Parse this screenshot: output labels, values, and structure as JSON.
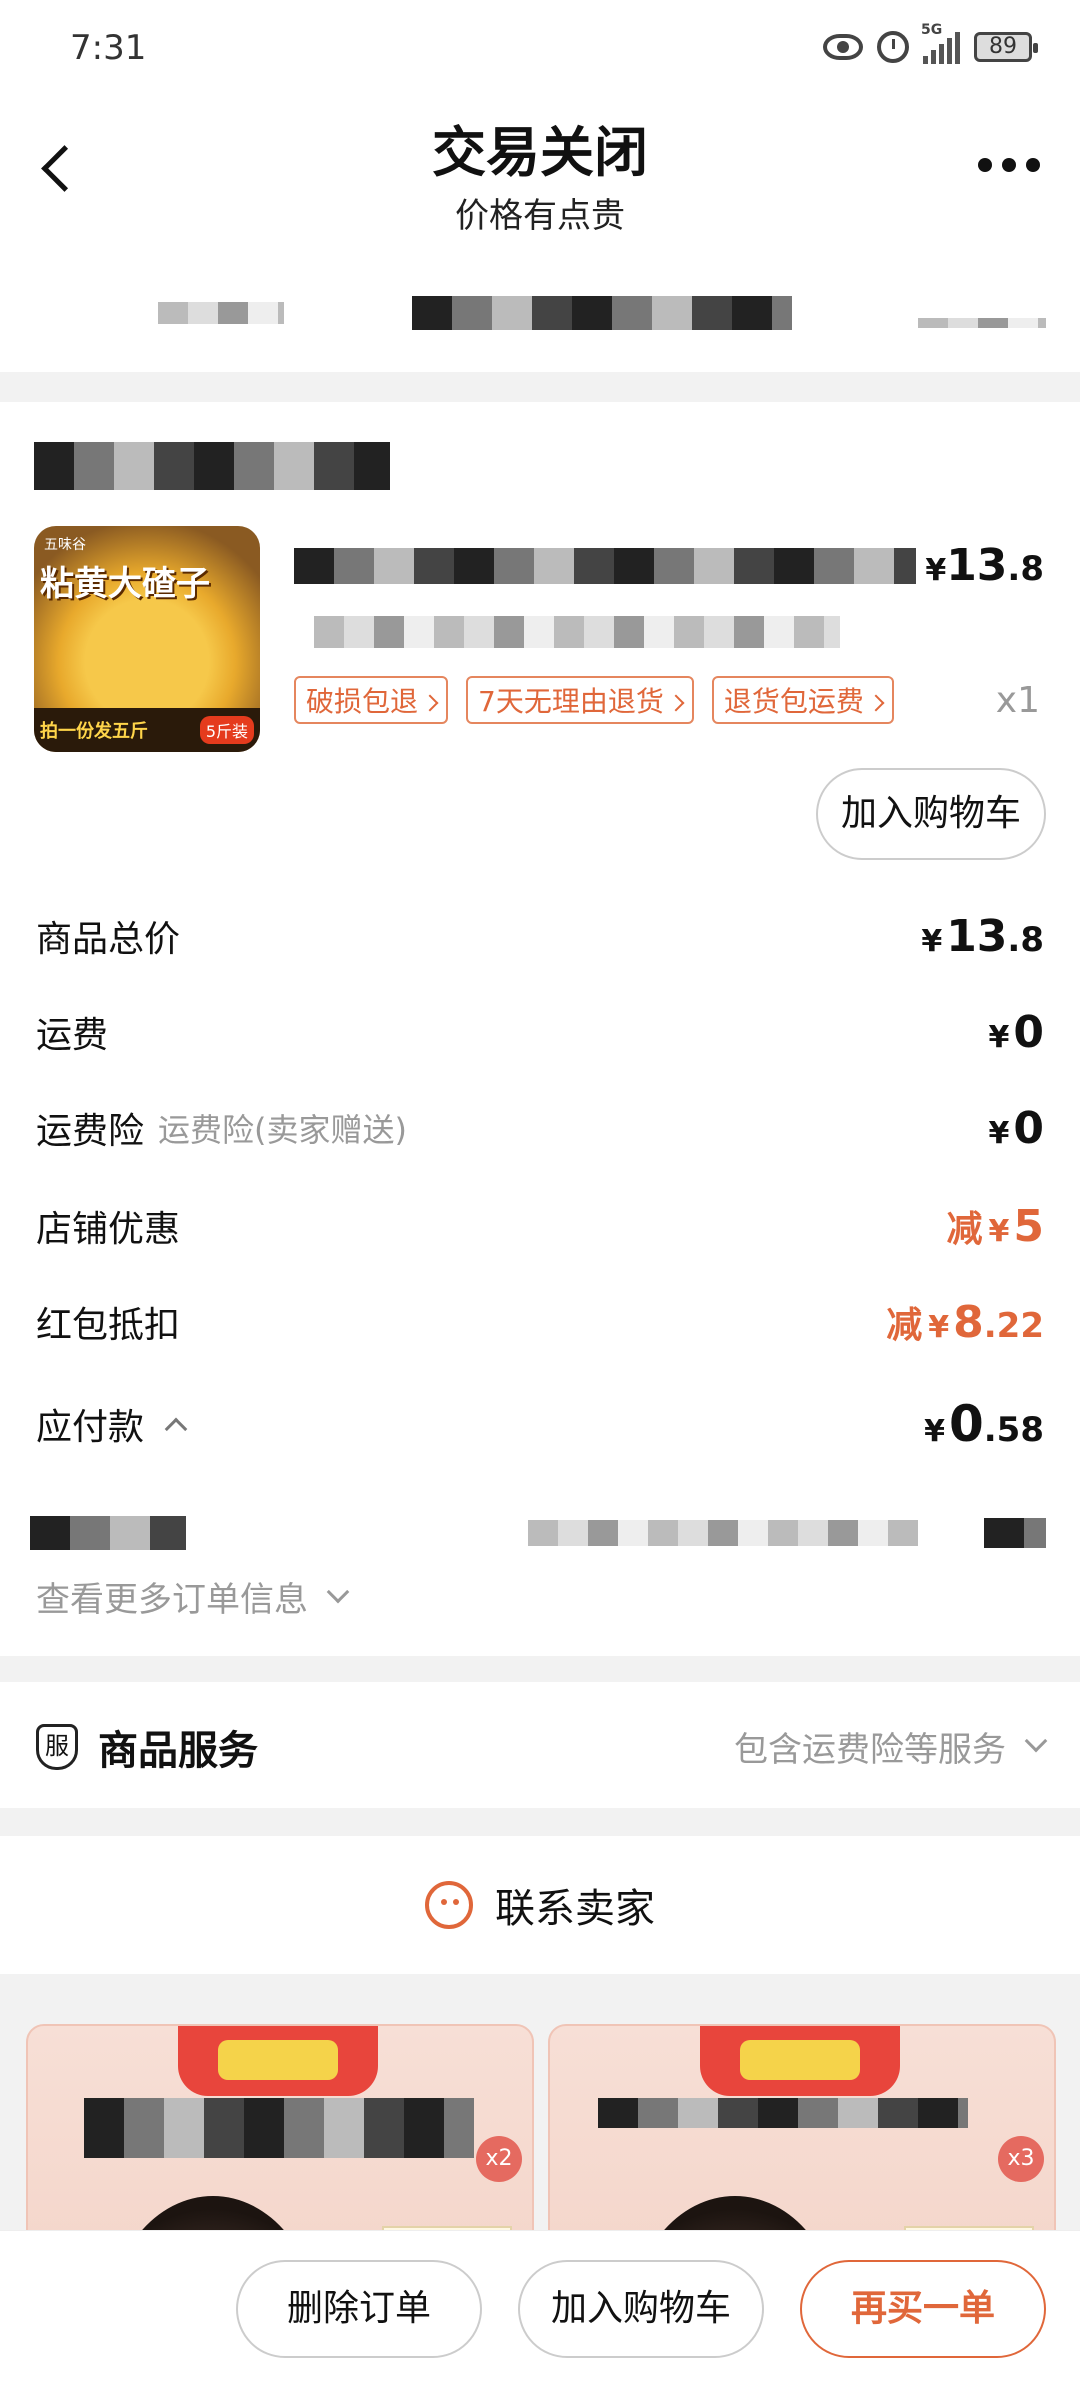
{
  "status_bar": {
    "time": "7:31",
    "network": "5G",
    "battery": "89"
  },
  "header": {
    "title": "交易关闭",
    "subtitle": "价格有点贵"
  },
  "product": {
    "image_text": "粘黄大碴子",
    "image_brand": "五味谷",
    "image_banner": "拍一份发五斤",
    "image_badge": "5斤装",
    "price_yen": "¥",
    "price_int": "13",
    "price_dec": ".8",
    "quantity": "x1",
    "tags": [
      "破损包退",
      "7天无理由退货",
      "退货包运费"
    ],
    "add_cart": "加入购物车"
  },
  "summary": {
    "total_label": "商品总价",
    "total_int": "13",
    "total_dec": ".8",
    "shipping_label": "运费",
    "shipping_int": "0",
    "insurance_label": "运费险",
    "insurance_sub": "运费险(卖家赠送)",
    "insurance_int": "0",
    "shop_discount_label": "店铺优惠",
    "shop_discount_prefix": "减",
    "shop_discount_int": "5",
    "redpacket_label": "红包抵扣",
    "redpacket_prefix": "减",
    "redpacket_int": "8",
    "redpacket_dec": ".22",
    "payable_label": "应付款",
    "payable_int": "0",
    "payable_dec": ".58",
    "yen": "¥"
  },
  "more_info": "查看更多订单信息",
  "service": {
    "icon_text": "服",
    "title": "商品服务",
    "desc": "包含运费险等服务"
  },
  "contact": {
    "label": "联系卖家"
  },
  "recommend": [
    {
      "badge": "x2"
    },
    {
      "badge": "x3"
    }
  ],
  "actions": {
    "delete": "删除订单",
    "add_cart": "加入购物车",
    "rebuy": "再买一单"
  },
  "colors": {
    "accent": "#e0673a"
  }
}
